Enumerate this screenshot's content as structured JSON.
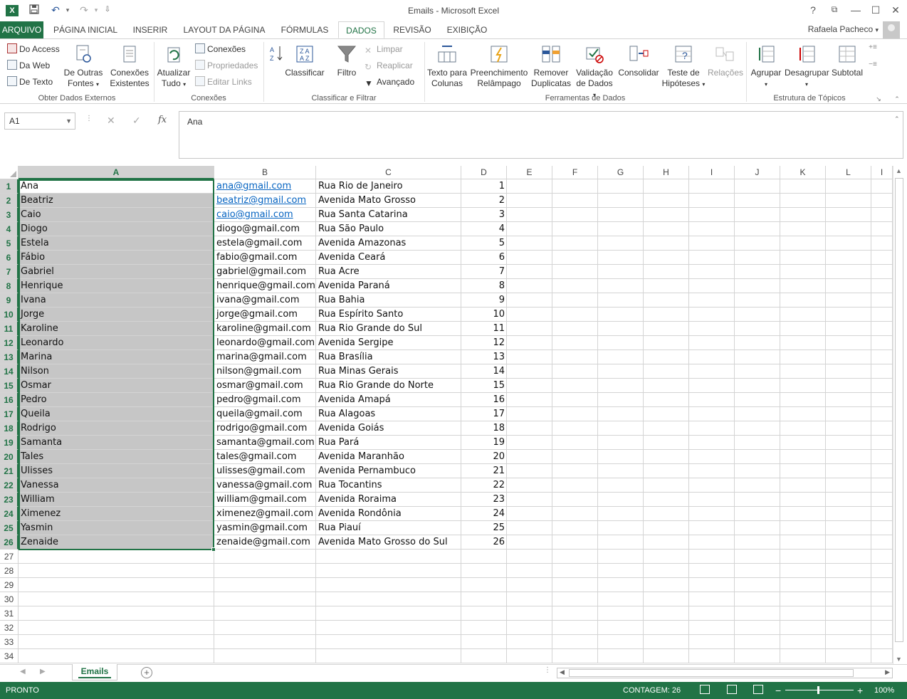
{
  "window": {
    "title": "Emails - Microsoft Excel",
    "help": "?",
    "restore": "⧉",
    "minimize": "—",
    "maximize": "☐",
    "close": "✕"
  },
  "quick_access": {
    "undo": "↶",
    "redo": "↷",
    "customize": "⇩"
  },
  "ribbon_tabs": [
    "ARQUIVO",
    "PÁGINA INICIAL",
    "INSERIR",
    "LAYOUT DA PÁGINA",
    "FÓRMULAS",
    "DADOS",
    "REVISÃO",
    "EXIBIÇÃO"
  ],
  "active_tab": "DADOS",
  "user": "Rafaela Pacheco",
  "ribbon": {
    "obter": {
      "access": "Do Access",
      "web": "Da Web",
      "texto": "De Texto",
      "outras_1": "De Outras",
      "outras_2": "Fontes",
      "existentes_1": "Conexões",
      "existentes_2": "Existentes",
      "label": "Obter Dados Externos"
    },
    "conexoes": {
      "atualizar_1": "Atualizar",
      "atualizar_2": "Tudo",
      "conexoes": "Conexões",
      "propriedades": "Propriedades",
      "editar": "Editar Links",
      "label": "Conexões"
    },
    "classificar": {
      "az": "A↓Z",
      "classificar": "Classificar",
      "filtro": "Filtro",
      "limpar": "Limpar",
      "reaplicar": "Reaplicar",
      "avancado": "Avançado",
      "label": "Classificar e Filtrar"
    },
    "ferramentas": {
      "texto_1": "Texto para",
      "texto_2": "Colunas",
      "preench_1": "Preenchimento",
      "preench_2": "Relâmpago",
      "remover_1": "Remover",
      "remover_2": "Duplicatas",
      "valid_1": "Validação",
      "valid_2": "de Dados",
      "consolidar": "Consolidar",
      "teste_1": "Teste de",
      "teste_2": "Hipóteses",
      "relacoes": "Relações",
      "label": "Ferramentas de Dados"
    },
    "estrutura": {
      "agrupar": "Agrupar",
      "desagrupar": "Desagrupar",
      "subtotal": "Subtotal",
      "label": "Estrutura de Tópicos"
    }
  },
  "formula_bar": {
    "name_box": "A1",
    "fx": "fx",
    "cancel": "✕",
    "enter": "✓",
    "content": "Ana"
  },
  "columns": [
    "A",
    "B",
    "C",
    "D",
    "E",
    "F",
    "G",
    "H",
    "I",
    "J",
    "K",
    "L",
    "I"
  ],
  "rows": [
    {
      "n": "1",
      "a": "Ana",
      "b": "ana@gmail.com",
      "c": "Rua Rio de Janeiro",
      "d": "1",
      "link": true
    },
    {
      "n": "2",
      "a": "Beatriz",
      "b": "beatriz@gmail.com",
      "c": "Avenida Mato Grosso",
      "d": "2",
      "link": true
    },
    {
      "n": "3",
      "a": "Caio",
      "b": "caio@gmail.com",
      "c": "Rua Santa Catarina",
      "d": "3",
      "link": true
    },
    {
      "n": "4",
      "a": "Diogo",
      "b": "diogo@gmail.com",
      "c": "Rua São Paulo",
      "d": "4"
    },
    {
      "n": "5",
      "a": "Estela",
      "b": "estela@gmail.com",
      "c": "Avenida Amazonas",
      "d": "5"
    },
    {
      "n": "6",
      "a": "Fábio",
      "b": "fabio@gmail.com",
      "c": "Avenida Ceará",
      "d": "6"
    },
    {
      "n": "7",
      "a": "Gabriel",
      "b": "gabriel@gmail.com",
      "c": "Rua Acre",
      "d": "7"
    },
    {
      "n": "8",
      "a": "Henrique",
      "b": "henrique@gmail.com",
      "c": "Avenida Paraná",
      "d": "8"
    },
    {
      "n": "9",
      "a": "Ivana",
      "b": "ivana@gmail.com",
      "c": "Rua Bahia",
      "d": "9"
    },
    {
      "n": "10",
      "a": "Jorge",
      "b": "jorge@gmail.com",
      "c": "Rua Espírito Santo",
      "d": "10"
    },
    {
      "n": "11",
      "a": "Karoline",
      "b": "karoline@gmail.com",
      "c": "Rua Rio Grande do Sul",
      "d": "11"
    },
    {
      "n": "12",
      "a": "Leonardo",
      "b": "leonardo@gmail.com",
      "c": "Avenida Sergipe",
      "d": "12"
    },
    {
      "n": "13",
      "a": "Marina",
      "b": "marina@gmail.com",
      "c": "Rua Brasília",
      "d": "13"
    },
    {
      "n": "14",
      "a": "Nilson",
      "b": "nilson@gmail.com",
      "c": "Rua Minas Gerais",
      "d": "14"
    },
    {
      "n": "15",
      "a": "Osmar",
      "b": "osmar@gmail.com",
      "c": "Rua Rio Grande do Norte",
      "d": "15"
    },
    {
      "n": "16",
      "a": "Pedro",
      "b": "pedro@gmail.com",
      "c": "Avenida Amapá",
      "d": "16"
    },
    {
      "n": "17",
      "a": "Queila",
      "b": "queila@gmail.com",
      "c": "Rua Alagoas",
      "d": "17"
    },
    {
      "n": "18",
      "a": "Rodrigo",
      "b": "rodrigo@gmail.com",
      "c": "Avenida Goiás",
      "d": "18"
    },
    {
      "n": "19",
      "a": "Samanta",
      "b": "samanta@gmail.com",
      "c": "Rua Pará",
      "d": "19"
    },
    {
      "n": "20",
      "a": "Tales",
      "b": "tales@gmail.com",
      "c": "Avenida Maranhão",
      "d": "20"
    },
    {
      "n": "21",
      "a": "Ulisses",
      "b": "ulisses@gmail.com",
      "c": "Avenida Pernambuco",
      "d": "21"
    },
    {
      "n": "22",
      "a": "Vanessa",
      "b": "vanessa@gmail.com",
      "c": "Rua Tocantins",
      "d": "22"
    },
    {
      "n": "23",
      "a": "William",
      "b": "william@gmail.com",
      "c": "Avenida Roraima",
      "d": "23"
    },
    {
      "n": "24",
      "a": "Ximenez",
      "b": "ximenez@gmail.com",
      "c": "Avenida Rondônia",
      "d": "24"
    },
    {
      "n": "25",
      "a": "Yasmin",
      "b": "yasmin@gmail.com",
      "c": "Rua Piauí",
      "d": "25"
    },
    {
      "n": "26",
      "a": "Zenaide",
      "b": "zenaide@gmail.com",
      "c": "Avenida Mato Grosso do Sul",
      "d": "26"
    },
    {
      "n": "27",
      "a": "",
      "b": "",
      "c": "",
      "d": ""
    },
    {
      "n": "28",
      "a": "",
      "b": "",
      "c": "",
      "d": ""
    },
    {
      "n": "29",
      "a": "",
      "b": "",
      "c": "",
      "d": ""
    },
    {
      "n": "30",
      "a": "",
      "b": "",
      "c": "",
      "d": ""
    },
    {
      "n": "31",
      "a": "",
      "b": "",
      "c": "",
      "d": ""
    },
    {
      "n": "32",
      "a": "",
      "b": "",
      "c": "",
      "d": ""
    },
    {
      "n": "33",
      "a": "",
      "b": "",
      "c": "",
      "d": ""
    },
    {
      "n": "34",
      "a": "",
      "b": "",
      "c": "",
      "d": ""
    }
  ],
  "sheet_tab": "Emails",
  "add_sheet": "+",
  "status": {
    "ready": "PRONTO",
    "count": "CONTAGEM: 26",
    "zoom": "100%",
    "zoom_minus": "−",
    "zoom_plus": "+"
  },
  "colors": {
    "accent": "#217346",
    "link": "#0563c1",
    "selection": "#c6c6c6"
  }
}
